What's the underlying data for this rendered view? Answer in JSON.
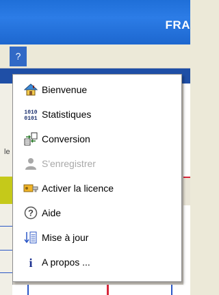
{
  "window": {
    "title_fragment": "FRA"
  },
  "menubar": {
    "help_label": "?"
  },
  "background": {
    "stub_text": "le"
  },
  "menu": {
    "items": [
      {
        "label": "Bienvenue",
        "icon": "home-icon",
        "enabled": true
      },
      {
        "label": "Statistiques",
        "icon": "binary-stats-icon",
        "enabled": true
      },
      {
        "label": "Conversion",
        "icon": "conversion-icon",
        "enabled": true
      },
      {
        "label": "S'enregistrer",
        "icon": "user-icon",
        "enabled": false
      },
      {
        "label": "Activer la licence",
        "icon": "key-icon",
        "enabled": true
      },
      {
        "label": "Aide",
        "icon": "help-icon",
        "enabled": true
      },
      {
        "label": "Mise à jour",
        "icon": "update-icon",
        "enabled": true
      },
      {
        "label": "A propos ...",
        "icon": "info-icon",
        "enabled": true
      }
    ]
  },
  "colors": {
    "title_bar": "#2c7ce6",
    "menu_highlight": "#3169c6",
    "disabled_text": "#a8a8a8"
  }
}
